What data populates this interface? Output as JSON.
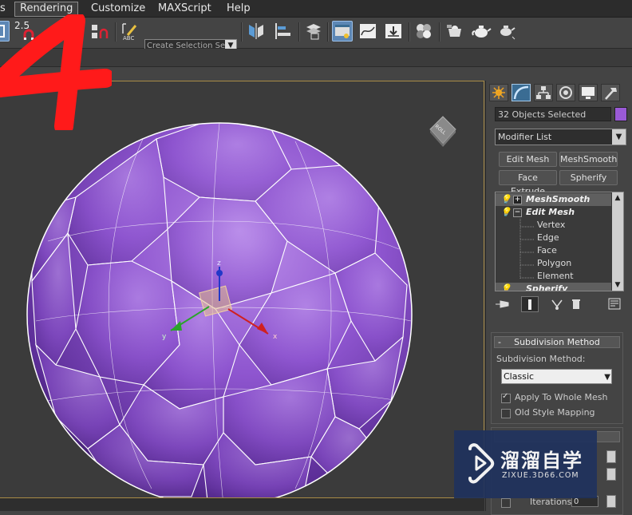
{
  "menu": {
    "items": [
      {
        "label": "s"
      },
      {
        "label": "Rendering"
      },
      {
        "label": "Customize"
      },
      {
        "label": "MAXScript"
      },
      {
        "label": "Help"
      }
    ]
  },
  "toolbar": {
    "snap_value": "2.5",
    "selection_set_placeholder": "Create Selection Se",
    "icons": [
      "snap-toggle-icon",
      "angle-snap-icon",
      "percent-snap-icon",
      "spinner-snap-icon",
      "edit-named-selection-icon",
      "mirror-icon",
      "align-icon",
      "layer-manager-icon",
      "scene-explorer-icon",
      "curve-editor-icon",
      "schematic-view-icon",
      "material-editor-icon",
      "render-setup-icon",
      "rendered-frame-window-icon",
      "render-production-icon"
    ]
  },
  "viewport": {
    "gizmo_labels": {
      "z": "z",
      "y": "y",
      "x": "x"
    },
    "object_color": "#8a52c8",
    "wire_color": "#ffffff"
  },
  "annotation": {
    "step_number": "4",
    "color": "#ff1a1a"
  },
  "command_panel": {
    "tabs": [
      "create-tab",
      "modify-tab",
      "hierarchy-tab",
      "motion-tab",
      "display-tab",
      "utilities-tab"
    ],
    "selection_text": "32 Objects Selected",
    "selection_color": "#9a5ad6",
    "modifier_list_label": "Modifier List",
    "quick_buttons": [
      {
        "label": "Edit Mesh"
      },
      {
        "label": "MeshSmooth"
      },
      {
        "label": "Face Extrude"
      },
      {
        "label": "Spherify"
      }
    ],
    "stack": {
      "items": [
        {
          "label": "MeshSmooth",
          "expanded": false
        },
        {
          "label": "Edit Mesh",
          "expanded": true,
          "children": [
            "Vertex",
            "Edge",
            "Face",
            "Polygon",
            "Element"
          ]
        },
        {
          "label": "Spherify",
          "expanded": false
        }
      ]
    },
    "rollout": {
      "title": "Subdivision Method",
      "collapse_symbol": "-",
      "method_label": "Subdivision Method:",
      "method_value": "Classic",
      "apply_whole_mesh": {
        "label": "Apply To Whole Mesh",
        "checked": true
      },
      "old_style_mapping": {
        "label": "Old Style Mapping",
        "checked": false
      },
      "iterations_label": "Iterations:",
      "iterations_value": "0"
    }
  },
  "watermark": {
    "title": "溜溜自学",
    "url": "ZIXUE.3D66.COM"
  }
}
